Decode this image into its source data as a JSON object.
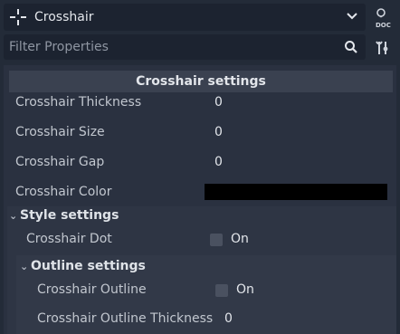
{
  "node_selector": {
    "title": "Crosshair",
    "icon": "crosshair-node-icon",
    "doc_label": "DOC"
  },
  "filter": {
    "placeholder": "Filter Properties"
  },
  "section": {
    "title": "Crosshair settings"
  },
  "properties": [
    {
      "label": "Crosshair Thickness",
      "value": "0"
    },
    {
      "label": "Crosshair Size",
      "value": "0"
    },
    {
      "label": "Crosshair Gap",
      "value": "0"
    },
    {
      "label": "Crosshair Color",
      "value": "#000000"
    }
  ],
  "style_group": {
    "title": "Style settings",
    "dot": {
      "label": "Crosshair Dot",
      "checkbox_label": "On",
      "checked": false
    }
  },
  "outline_group": {
    "title": "Outline settings",
    "outline": {
      "label": "Crosshair Outline",
      "checkbox_label": "On",
      "checked": false
    },
    "thickness": {
      "label": "Crosshair Outline Thickness",
      "value": "0"
    }
  }
}
